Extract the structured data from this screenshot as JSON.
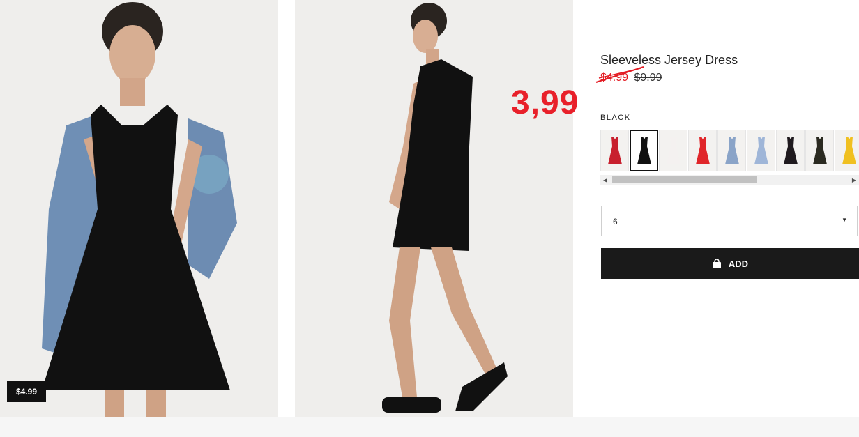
{
  "gallery": {
    "images": [
      {
        "alt": "model-front-denim-jacket"
      },
      {
        "alt": "model-side-view"
      }
    ],
    "price_badge": "$4.99"
  },
  "product": {
    "title": "Sleeveless Jersey Dress",
    "sale_price": "$4.99",
    "original_price": "$9.99",
    "annotation_price": "3,99",
    "color_label": "BLACK",
    "swatches": [
      {
        "name": "red-striped",
        "color": "#c8202e"
      },
      {
        "name": "black",
        "color": "#111111"
      },
      {
        "name": "white-floral",
        "color": "#f4f1f0"
      },
      {
        "name": "red-floral",
        "color": "#e0262a"
      },
      {
        "name": "light-blue",
        "color": "#8aa4c8"
      },
      {
        "name": "blue-floral",
        "color": "#9fb6d8"
      },
      {
        "name": "black-floral",
        "color": "#1f1a1e"
      },
      {
        "name": "black-yellow-floral",
        "color": "#2a2a20"
      },
      {
        "name": "yellow",
        "color": "#f0c020"
      }
    ],
    "selected_swatch": 1,
    "size_value": "6",
    "add_label": "ADD"
  },
  "colors": {
    "sale": "#e31b23",
    "annotation": "#e8202a",
    "button_bg": "#1a1a1a"
  }
}
